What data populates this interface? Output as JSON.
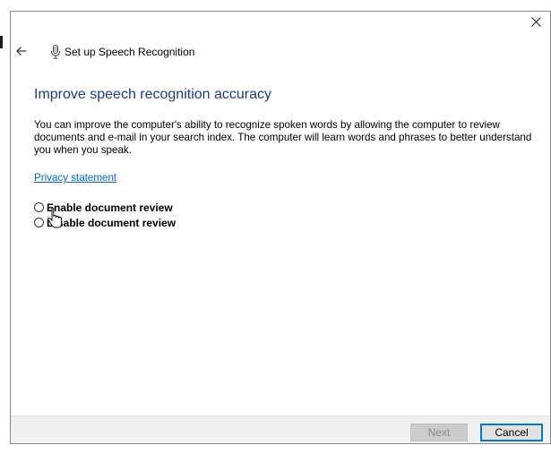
{
  "window": {
    "title": "Set up Speech Recognition"
  },
  "header": {
    "back_icon": "back-arrow-icon",
    "app_icon": "microphone-icon",
    "title": "Set up Speech Recognition",
    "close_icon": "close-icon"
  },
  "main": {
    "heading": "Improve speech recognition accuracy",
    "description": "You can improve the computer's ability to recognize spoken words by allowing the computer to review documents and e-mail in your search index. The computer will learn words and phrases to better understand you when you speak.",
    "privacy_link": "Privacy statement",
    "options": [
      {
        "label": "Enable document review",
        "selected": false
      },
      {
        "label": "Disable document review",
        "selected": false
      }
    ]
  },
  "footer": {
    "next_label": "Next",
    "next_enabled": false,
    "cancel_label": "Cancel"
  },
  "colors": {
    "heading": "#1c3a8a",
    "link": "#0066cc",
    "focus_border": "#0078d7"
  }
}
